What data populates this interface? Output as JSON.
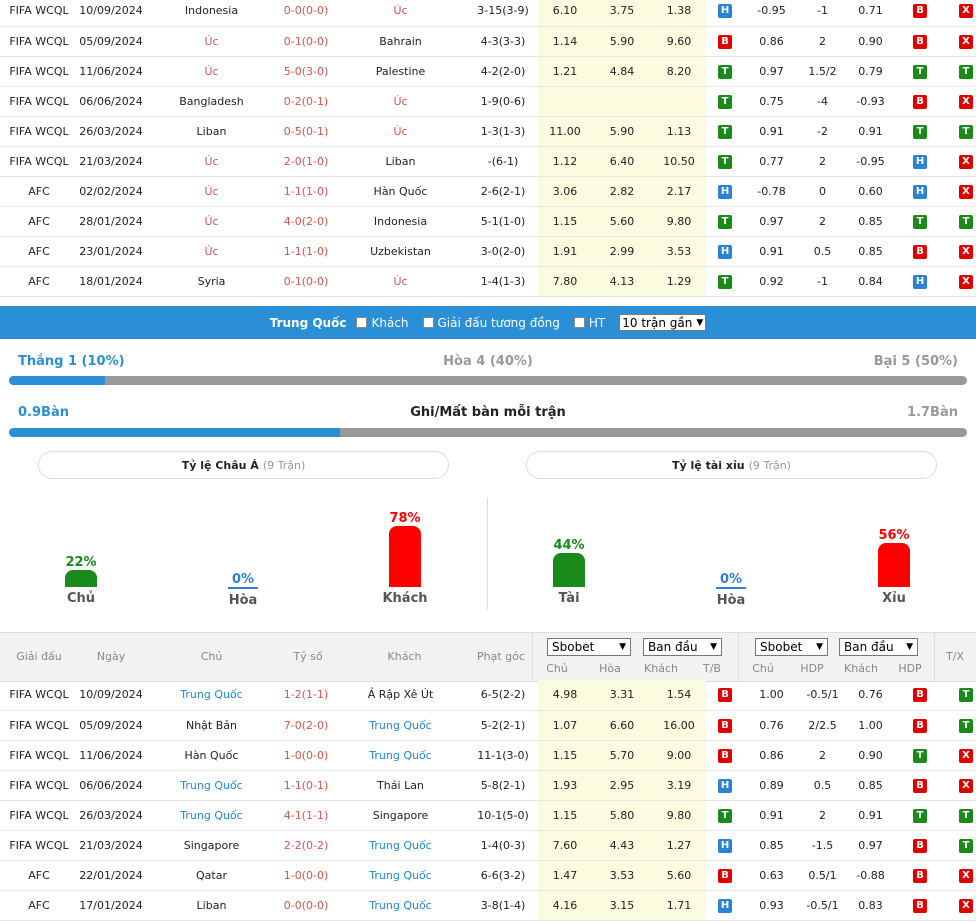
{
  "top_matches": [
    {
      "league": "FIFA WCQL",
      "date": "10/09/2024",
      "home": "Indonesia",
      "home_style": "",
      "score": "0-0(0-0)",
      "away": "Úc",
      "away_style": "home-red",
      "corners": "3-15(3-9)",
      "o1": "6.10",
      "o2": "3.75",
      "o3": "1.38",
      "r1": "H",
      "h1": "-0.95",
      "h2": "-1",
      "h3": "0.71",
      "r2": "B",
      "r3": "X"
    },
    {
      "league": "FIFA WCQL",
      "date": "05/09/2024",
      "home": "Úc",
      "home_style": "home-red",
      "score": "0-1(0-0)",
      "away": "Bahrain",
      "away_style": "",
      "corners": "4-3(3-3)",
      "o1": "1.14",
      "o2": "5.90",
      "o3": "9.60",
      "r1": "B",
      "h1": "0.86",
      "h2": "2",
      "h3": "0.90",
      "r2": "B",
      "r3": "X"
    },
    {
      "league": "FIFA WCQL",
      "date": "11/06/2024",
      "home": "Úc",
      "home_style": "home-red",
      "score": "5-0(3-0)",
      "away": "Palestine",
      "away_style": "",
      "corners": "4-2(2-0)",
      "o1": "1.21",
      "o2": "4.84",
      "o3": "8.20",
      "r1": "T",
      "h1": "0.97",
      "h2": "1.5/2",
      "h3": "0.79",
      "r2": "T",
      "r3": "T"
    },
    {
      "league": "FIFA WCQL",
      "date": "06/06/2024",
      "home": "Bangladesh",
      "home_style": "",
      "score": "0-2(0-1)",
      "away": "Úc",
      "away_style": "home-red",
      "corners": "1-9(0-6)",
      "o1": "",
      "o2": "",
      "o3": "",
      "r1": "T",
      "h1": "0.75",
      "h2": "-4",
      "h3": "-0.93",
      "r2": "B",
      "r3": "X"
    },
    {
      "league": "FIFA WCQL",
      "date": "26/03/2024",
      "home": "Liban",
      "home_style": "",
      "score": "0-5(0-1)",
      "away": "Úc",
      "away_style": "home-red",
      "corners": "1-3(1-3)",
      "o1": "11.00",
      "o2": "5.90",
      "o3": "1.13",
      "r1": "T",
      "h1": "0.91",
      "h2": "-2",
      "h3": "0.91",
      "r2": "T",
      "r3": "T"
    },
    {
      "league": "FIFA WCQL",
      "date": "21/03/2024",
      "home": "Úc",
      "home_style": "home-red",
      "score": "2-0(1-0)",
      "away": "Liban",
      "away_style": "",
      "corners": "-(6-1)",
      "o1": "1.12",
      "o2": "6.40",
      "o3": "10.50",
      "r1": "T",
      "h1": "0.77",
      "h2": "2",
      "h3": "-0.95",
      "r2": "H",
      "r3": "X"
    },
    {
      "league": "AFC",
      "date": "02/02/2024",
      "home": "Úc",
      "home_style": "home-red",
      "score": "1-1(1-0)",
      "away": "Hàn Quốc",
      "away_style": "",
      "corners": "2-6(2-1)",
      "o1": "3.06",
      "o2": "2.82",
      "o3": "2.17",
      "r1": "H",
      "h1": "-0.78",
      "h2": "0",
      "h3": "0.60",
      "r2": "H",
      "r3": "X"
    },
    {
      "league": "AFC",
      "date": "28/01/2024",
      "home": "Úc",
      "home_style": "home-red",
      "score": "4-0(2-0)",
      "away": "Indonesia",
      "away_style": "",
      "corners": "5-1(1-0)",
      "o1": "1.15",
      "o2": "5.60",
      "o3": "9.80",
      "r1": "T",
      "h1": "0.97",
      "h2": "2",
      "h3": "0.85",
      "r2": "T",
      "r3": "T"
    },
    {
      "league": "AFC",
      "date": "23/01/2024",
      "home": "Úc",
      "home_style": "home-red",
      "score": "1-1(1-0)",
      "away": "Uzbekistan",
      "away_style": "",
      "corners": "3-0(2-0)",
      "o1": "1.91",
      "o2": "2.99",
      "o3": "3.53",
      "r1": "H",
      "h1": "0.91",
      "h2": "0.5",
      "h3": "0.85",
      "r2": "B",
      "r3": "X"
    },
    {
      "league": "AFC",
      "date": "18/01/2024",
      "home": "Syria",
      "home_style": "",
      "score": "0-1(0-0)",
      "away": "Úc",
      "away_style": "home-red",
      "corners": "1-4(1-3)",
      "o1": "7.80",
      "o2": "4.13",
      "o3": "1.29",
      "r1": "T",
      "h1": "0.92",
      "h2": "-1",
      "h3": "0.84",
      "r2": "H",
      "r3": "X"
    }
  ],
  "filter": {
    "team": "Trung Quốc",
    "opt_away": "Khách",
    "opt_same_league": "Giải đấu tương đồng",
    "opt_ht": "HT",
    "select_value": "10 trận gần"
  },
  "summary": {
    "win": "Thắng 1 (10%)",
    "draw": "Hòa 4 (40%)",
    "loss": "Bại 5 (50%)",
    "win_fraction": 0.1,
    "goals_for": "0.9Bàn",
    "goals_title": "Ghi/Mất bàn mỗi trận",
    "goals_against": "1.7Bàn",
    "goals_fraction": 0.346
  },
  "asian": {
    "title": "Tỷ lệ Châu Á",
    "sub": "(9 Trận)",
    "items": [
      {
        "pct": "22%",
        "label": "Chủ",
        "value": 22,
        "color": "#1a8a1a"
      },
      {
        "pct": "0%",
        "label": "Hòa",
        "value": 0,
        "color": "#2b82d4"
      },
      {
        "pct": "78%",
        "label": "Khách",
        "value": 78,
        "color": "#ff0000"
      }
    ]
  },
  "ou": {
    "title": "Tỷ lệ tài xỉu",
    "sub": "(9 Trận)",
    "items": [
      {
        "pct": "44%",
        "label": "Tài",
        "value": 44,
        "color": "#1a8a1a"
      },
      {
        "pct": "0%",
        "label": "Hòa",
        "value": 0,
        "color": "#2b82d4"
      },
      {
        "pct": "56%",
        "label": "Xỉu",
        "value": 56,
        "color": "#ff0000"
      }
    ]
  },
  "header": {
    "league": "Giải đấu",
    "date": "Ngày",
    "home": "Chủ",
    "score": "Tỷ số",
    "away": "Khách",
    "corners": "Phạt góc",
    "book1": "Sbobet",
    "type1": "Ban đầu",
    "book2": "Sbobet",
    "type2": "Ban đầu",
    "s_home": "Chủ",
    "s_draw": "Hòa",
    "s_away": "Khách",
    "s_tb": "T/B",
    "s_home2": "Chủ",
    "s_hdp": "HDP",
    "s_away2": "Khách",
    "s_hdp2": "HDP",
    "tx": "T/X"
  },
  "bottom_matches": [
    {
      "league": "FIFA WCQL",
      "date": "10/09/2024",
      "home": "Trung Quốc",
      "home_style": "blue-team",
      "score": "1-2(1-1)",
      "away": "Ả Rập Xê Út",
      "away_style": "",
      "corners": "6-5(2-2)",
      "o1": "4.98",
      "o2": "3.31",
      "o3": "1.54",
      "r1": "B",
      "h1": "1.00",
      "h2": "-0.5/1",
      "h3": "0.76",
      "r2": "B",
      "r3": "T"
    },
    {
      "league": "FIFA WCQL",
      "date": "05/09/2024",
      "home": "Nhật Bản",
      "home_style": "",
      "score": "7-0(2-0)",
      "away": "Trung Quốc",
      "away_style": "blue-team",
      "corners": "5-2(2-1)",
      "o1": "1.07",
      "o2": "6.60",
      "o3": "16.00",
      "r1": "B",
      "h1": "0.76",
      "h2": "2/2.5",
      "h3": "1.00",
      "r2": "B",
      "r3": "T"
    },
    {
      "league": "FIFA WCQL",
      "date": "11/06/2024",
      "home": "Hàn Quốc",
      "home_style": "",
      "score": "1-0(0-0)",
      "away": "Trung Quốc",
      "away_style": "blue-team",
      "corners": "11-1(3-0)",
      "o1": "1.15",
      "o2": "5.70",
      "o3": "9.00",
      "r1": "B",
      "h1": "0.86",
      "h2": "2",
      "h3": "0.90",
      "r2": "T",
      "r3": "X"
    },
    {
      "league": "FIFA WCQL",
      "date": "06/06/2024",
      "home": "Trung Quốc",
      "home_style": "blue-team",
      "score": "1-1(0-1)",
      "away": "Thái Lan",
      "away_style": "",
      "corners": "5-8(2-1)",
      "o1": "1.93",
      "o2": "2.95",
      "o3": "3.19",
      "r1": "H",
      "h1": "0.89",
      "h2": "0.5",
      "h3": "0.85",
      "r2": "B",
      "r3": "X"
    },
    {
      "league": "FIFA WCQL",
      "date": "26/03/2024",
      "home": "Trung Quốc",
      "home_style": "blue-team",
      "score": "4-1(1-1)",
      "away": "Singapore",
      "away_style": "",
      "corners": "10-1(5-0)",
      "o1": "1.15",
      "o2": "5.80",
      "o3": "9.80",
      "r1": "T",
      "h1": "0.91",
      "h2": "2",
      "h3": "0.91",
      "r2": "T",
      "r3": "T"
    },
    {
      "league": "FIFA WCQL",
      "date": "21/03/2024",
      "home": "Singapore",
      "home_style": "",
      "score": "2-2(0-2)",
      "away": "Trung Quốc",
      "away_style": "blue-team",
      "corners": "1-4(0-3)",
      "o1": "7.60",
      "o2": "4.43",
      "o3": "1.27",
      "r1": "H",
      "h1": "0.85",
      "h2": "-1.5",
      "h3": "0.97",
      "r2": "B",
      "r3": "T"
    },
    {
      "league": "AFC",
      "date": "22/01/2024",
      "home": "Qatar",
      "home_style": "",
      "score": "1-0(0-0)",
      "away": "Trung Quốc",
      "away_style": "blue-team",
      "corners": "6-6(3-2)",
      "o1": "1.47",
      "o2": "3.53",
      "o3": "5.60",
      "r1": "B",
      "h1": "0.63",
      "h2": "0.5/1",
      "h3": "-0.88",
      "r2": "B",
      "r3": "X"
    },
    {
      "league": "AFC",
      "date": "17/01/2024",
      "home": "Liban",
      "home_style": "",
      "score": "0-0(0-0)",
      "away": "Trung Quốc",
      "away_style": "blue-team",
      "corners": "3-8(1-4)",
      "o1": "4.16",
      "o2": "3.15",
      "o3": "1.71",
      "r1": "H",
      "h1": "0.93",
      "h2": "-0.5/1",
      "h3": "0.83",
      "r2": "B",
      "r3": "X"
    }
  ]
}
